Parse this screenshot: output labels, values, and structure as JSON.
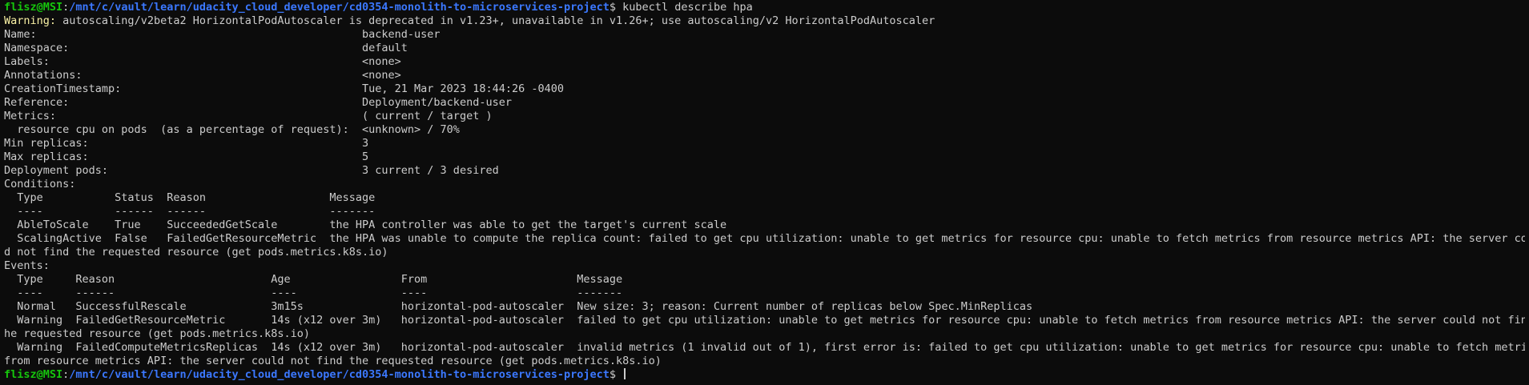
{
  "prompt": {
    "user_host": "flisz@MSI",
    "colon": ":",
    "path": "/mnt/c/vault/learn/udacity_cloud_developer/cd0354-monolith-to-microservices-project",
    "symbol": "$ "
  },
  "command": "kubectl describe hpa",
  "warning": {
    "label": "Warning:",
    "text": " autoscaling/v2beta2 HorizontalPodAutoscaler is deprecated in v1.23+, unavailable in v1.26+; use autoscaling/v2 HorizontalPodAutoscaler"
  },
  "output_lines": [
    "Name:                                                  backend-user",
    "Namespace:                                             default",
    "Labels:                                                <none>",
    "Annotations:                                           <none>",
    "CreationTimestamp:                                     Tue, 21 Mar 2023 18:44:26 -0400",
    "Reference:                                             Deployment/backend-user",
    "Metrics:                                               ( current / target )",
    "  resource cpu on pods  (as a percentage of request):  <unknown> / 70%",
    "Min replicas:                                          3",
    "Max replicas:                                          5",
    "Deployment pods:                                       3 current / 3 desired",
    "Conditions:",
    "  Type           Status  Reason                   Message",
    "  ----           ------  ------                   -------",
    "  AbleToScale    True    SucceededGetScale        the HPA controller was able to get the target's current scale",
    "  ScalingActive  False   FailedGetResourceMetric  the HPA was unable to compute the replica count: failed to get cpu utilization: unable to get metrics for resource cpu: unable to fetch metrics from resource metrics API: the server coul",
    "d not find the requested resource (get pods.metrics.k8s.io)",
    "Events:",
    "  Type     Reason                        Age                 From                       Message",
    "  ----     ------                        ----                ----                       -------",
    "  Normal   SuccessfulRescale             3m15s               horizontal-pod-autoscaler  New size: 3; reason: Current number of replicas below Spec.MinReplicas",
    "  Warning  FailedGetResourceMetric       14s (x12 over 3m)   horizontal-pod-autoscaler  failed to get cpu utilization: unable to get metrics for resource cpu: unable to fetch metrics from resource metrics API: the server could not find t",
    "he requested resource (get pods.metrics.k8s.io)",
    "  Warning  FailedComputeMetricsReplicas  14s (x12 over 3m)   horizontal-pod-autoscaler  invalid metrics (1 invalid out of 1), first error is: failed to get cpu utilization: unable to get metrics for resource cpu: unable to fetch metrics",
    "from resource metrics API: the server could not find the requested resource (get pods.metrics.k8s.io)"
  ],
  "colors": {
    "background": "#0c0c0c",
    "foreground": "#cccccc",
    "prompt_user": "#16c60c",
    "prompt_path": "#3b78ff",
    "warning": "#f9f1a5"
  }
}
